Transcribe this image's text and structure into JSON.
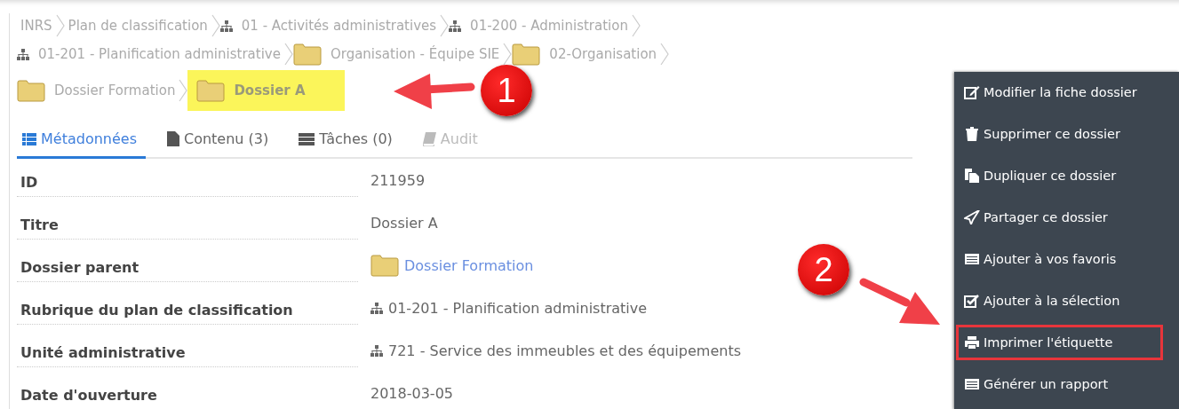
{
  "breadcrumb": [
    {
      "label": "INRS",
      "kind": "text",
      "highlighted": false
    },
    {
      "label": "Plan de classification",
      "kind": "text",
      "highlighted": false
    },
    {
      "label": "01 - Activités administratives",
      "kind": "tree",
      "highlighted": false
    },
    {
      "label": "01-200 - Administration",
      "kind": "tree",
      "highlighted": false
    },
    {
      "label": "01-201 - Planification administrative",
      "kind": "tree",
      "highlighted": false
    },
    {
      "label": "Organisation - Équipe SIE",
      "kind": "folder",
      "highlighted": false
    },
    {
      "label": "02-Organisation",
      "kind": "folder",
      "highlighted": false
    },
    {
      "label": "Dossier Formation",
      "kind": "folder",
      "highlighted": false
    },
    {
      "label": "Dossier A",
      "kind": "folder",
      "highlighted": true
    }
  ],
  "tabs": [
    {
      "label": "Métadonnées",
      "kind": "list",
      "selected": true,
      "disabled": false
    },
    {
      "label": "Contenu (3)",
      "kind": "file",
      "selected": false,
      "disabled": false
    },
    {
      "label": "Tâches (0)",
      "kind": "tasks",
      "selected": false,
      "disabled": false
    },
    {
      "label": "Audit",
      "kind": "book",
      "selected": false,
      "disabled": true
    }
  ],
  "fields": [
    {
      "label": "ID",
      "value": "211959",
      "kind": "text"
    },
    {
      "label": "Titre",
      "value": "Dossier A",
      "kind": "text"
    },
    {
      "label": "Dossier parent",
      "value": "Dossier Formation",
      "kind": "folder-link"
    },
    {
      "label": "Rubrique du plan de classification",
      "value": "01-201 - Planification administrative",
      "kind": "tree"
    },
    {
      "label": "Unité administrative",
      "value": "721 - Service des immeubles et des équipements",
      "kind": "tree"
    },
    {
      "label": "Date d'ouverture",
      "value": "2018-03-05",
      "kind": "text"
    }
  ],
  "actions_menu": [
    {
      "label": "Modifier la fiche dossier",
      "kind": "edit",
      "highlighted": false
    },
    {
      "label": "Supprimer ce dossier",
      "kind": "trash",
      "highlighted": false
    },
    {
      "label": "Dupliquer ce dossier",
      "kind": "copy",
      "highlighted": false
    },
    {
      "label": "Partager ce dossier",
      "kind": "send",
      "highlighted": false
    },
    {
      "label": "Ajouter à vos favoris",
      "kind": "list",
      "highlighted": false
    },
    {
      "label": "Ajouter à la sélection",
      "kind": "check",
      "highlighted": false
    },
    {
      "label": "Imprimer l'étiquette",
      "kind": "print",
      "highlighted": true
    },
    {
      "label": "Générer un rapport",
      "kind": "list",
      "highlighted": false
    }
  ],
  "callouts": [
    {
      "number": "1"
    },
    {
      "number": "2"
    }
  ]
}
